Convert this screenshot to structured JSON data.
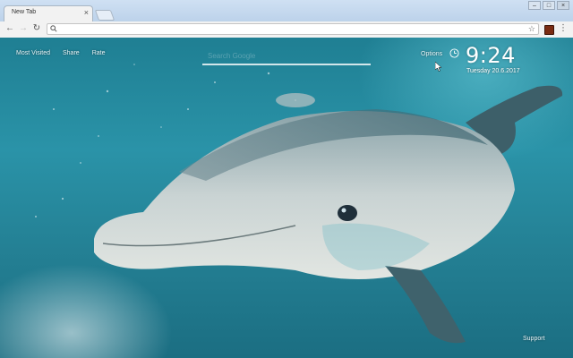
{
  "browser": {
    "tab_title": "New Tab",
    "tab_close": "×",
    "window_controls": [
      "–",
      "□",
      "×"
    ],
    "icons": {
      "back": "back-arrow-icon",
      "forward": "forward-arrow-icon",
      "reload": "reload-icon",
      "search": "search-icon",
      "bookmark": "star-icon",
      "extension": "extension-icon",
      "menu": "menu-icon"
    },
    "nav_glyphs": {
      "back": "←",
      "forward": "→",
      "reload": "↻",
      "search": "🔍",
      "star": "☆",
      "menu": "⋮"
    },
    "omnibox_value": ""
  },
  "newtab": {
    "links": [
      "Most Visited",
      "Share",
      "Rate"
    ],
    "search_placeholder": "Search Google",
    "options_label": "Options",
    "time": "9:24",
    "date": "Tuesday 20.6.2017",
    "support_label": "Support"
  },
  "colors": {
    "water": "#2a93a8",
    "text": "#ffffff",
    "extension_icon": "#7a2b12"
  }
}
